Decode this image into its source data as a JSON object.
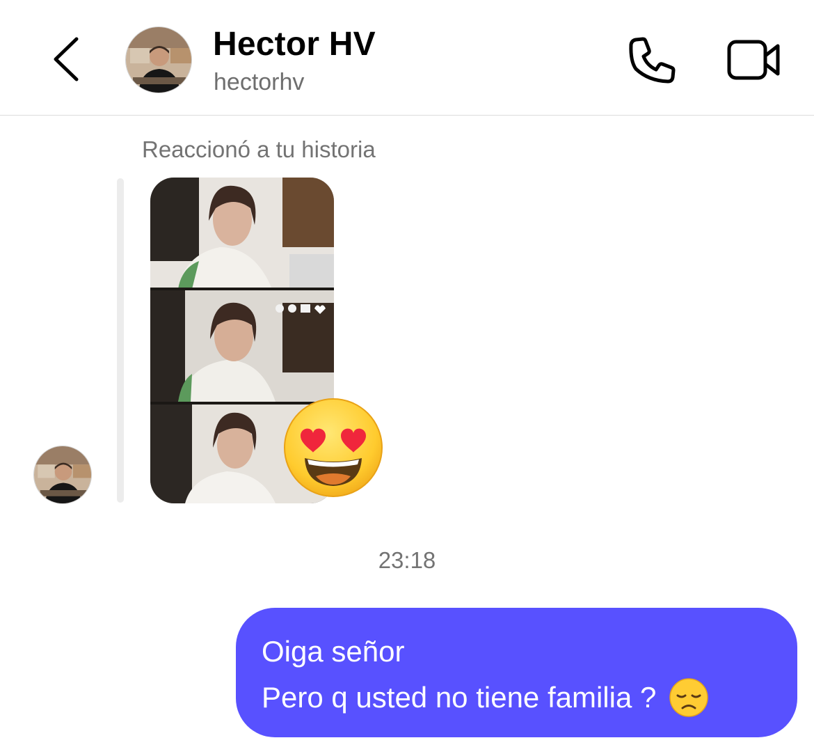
{
  "header": {
    "name": "Hector HV",
    "username": "hectorhv",
    "back_icon": "chevron-left-icon",
    "call_icon": "phone-icon",
    "video_icon": "video-camera-icon"
  },
  "thread": {
    "reaction_label": "Reaccionó a tu historia",
    "reaction_emoji": "heart-eyes-emoji",
    "timestamp": "23:18",
    "outgoing_message": {
      "lines": [
        "Oiga señor",
        "Pero q usted no tiene familia ?"
      ],
      "emoji": "disappointed-face-emoji"
    }
  },
  "colors": {
    "bubble": "#5851ff",
    "divider": "#dcdcdc",
    "muted_text": "#737373"
  }
}
